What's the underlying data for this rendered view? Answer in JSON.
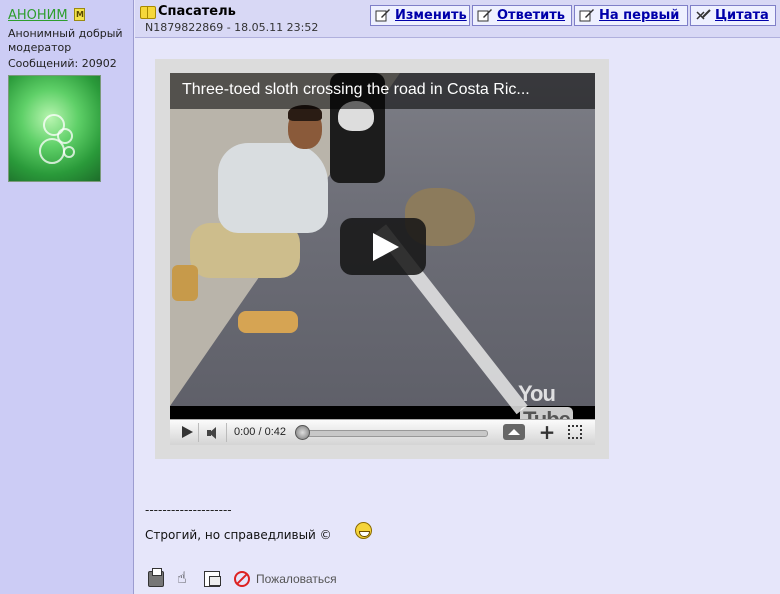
{
  "author": {
    "name": "АНОНИМ",
    "badge": "M",
    "title": "Анонимный добрый модератор",
    "posts": "Сообщений: 20902"
  },
  "post": {
    "title": "Спасатель",
    "meta": "N1879822869 - 18.05.11 23:52"
  },
  "toolbar": {
    "edit": "Изменить",
    "reply": "Ответить",
    "to_first": "На первый",
    "quote": "Цитата"
  },
  "video": {
    "title": "Three-toed sloth crossing the road in Costa Ric...",
    "time": "0:00 / 0:42",
    "logo_you": "You",
    "logo_tube": "Tube",
    "progress": 0
  },
  "signature": {
    "separator": "--------------------",
    "text": "Строгий, но справедливый ©"
  },
  "actions": {
    "report": "Пожаловаться"
  },
  "colors": {
    "page_bg": "#e6e6fa",
    "sidebar_bg": "#ccccf5",
    "author_link": "#2e9e2e",
    "button_text": "#0000aa"
  }
}
